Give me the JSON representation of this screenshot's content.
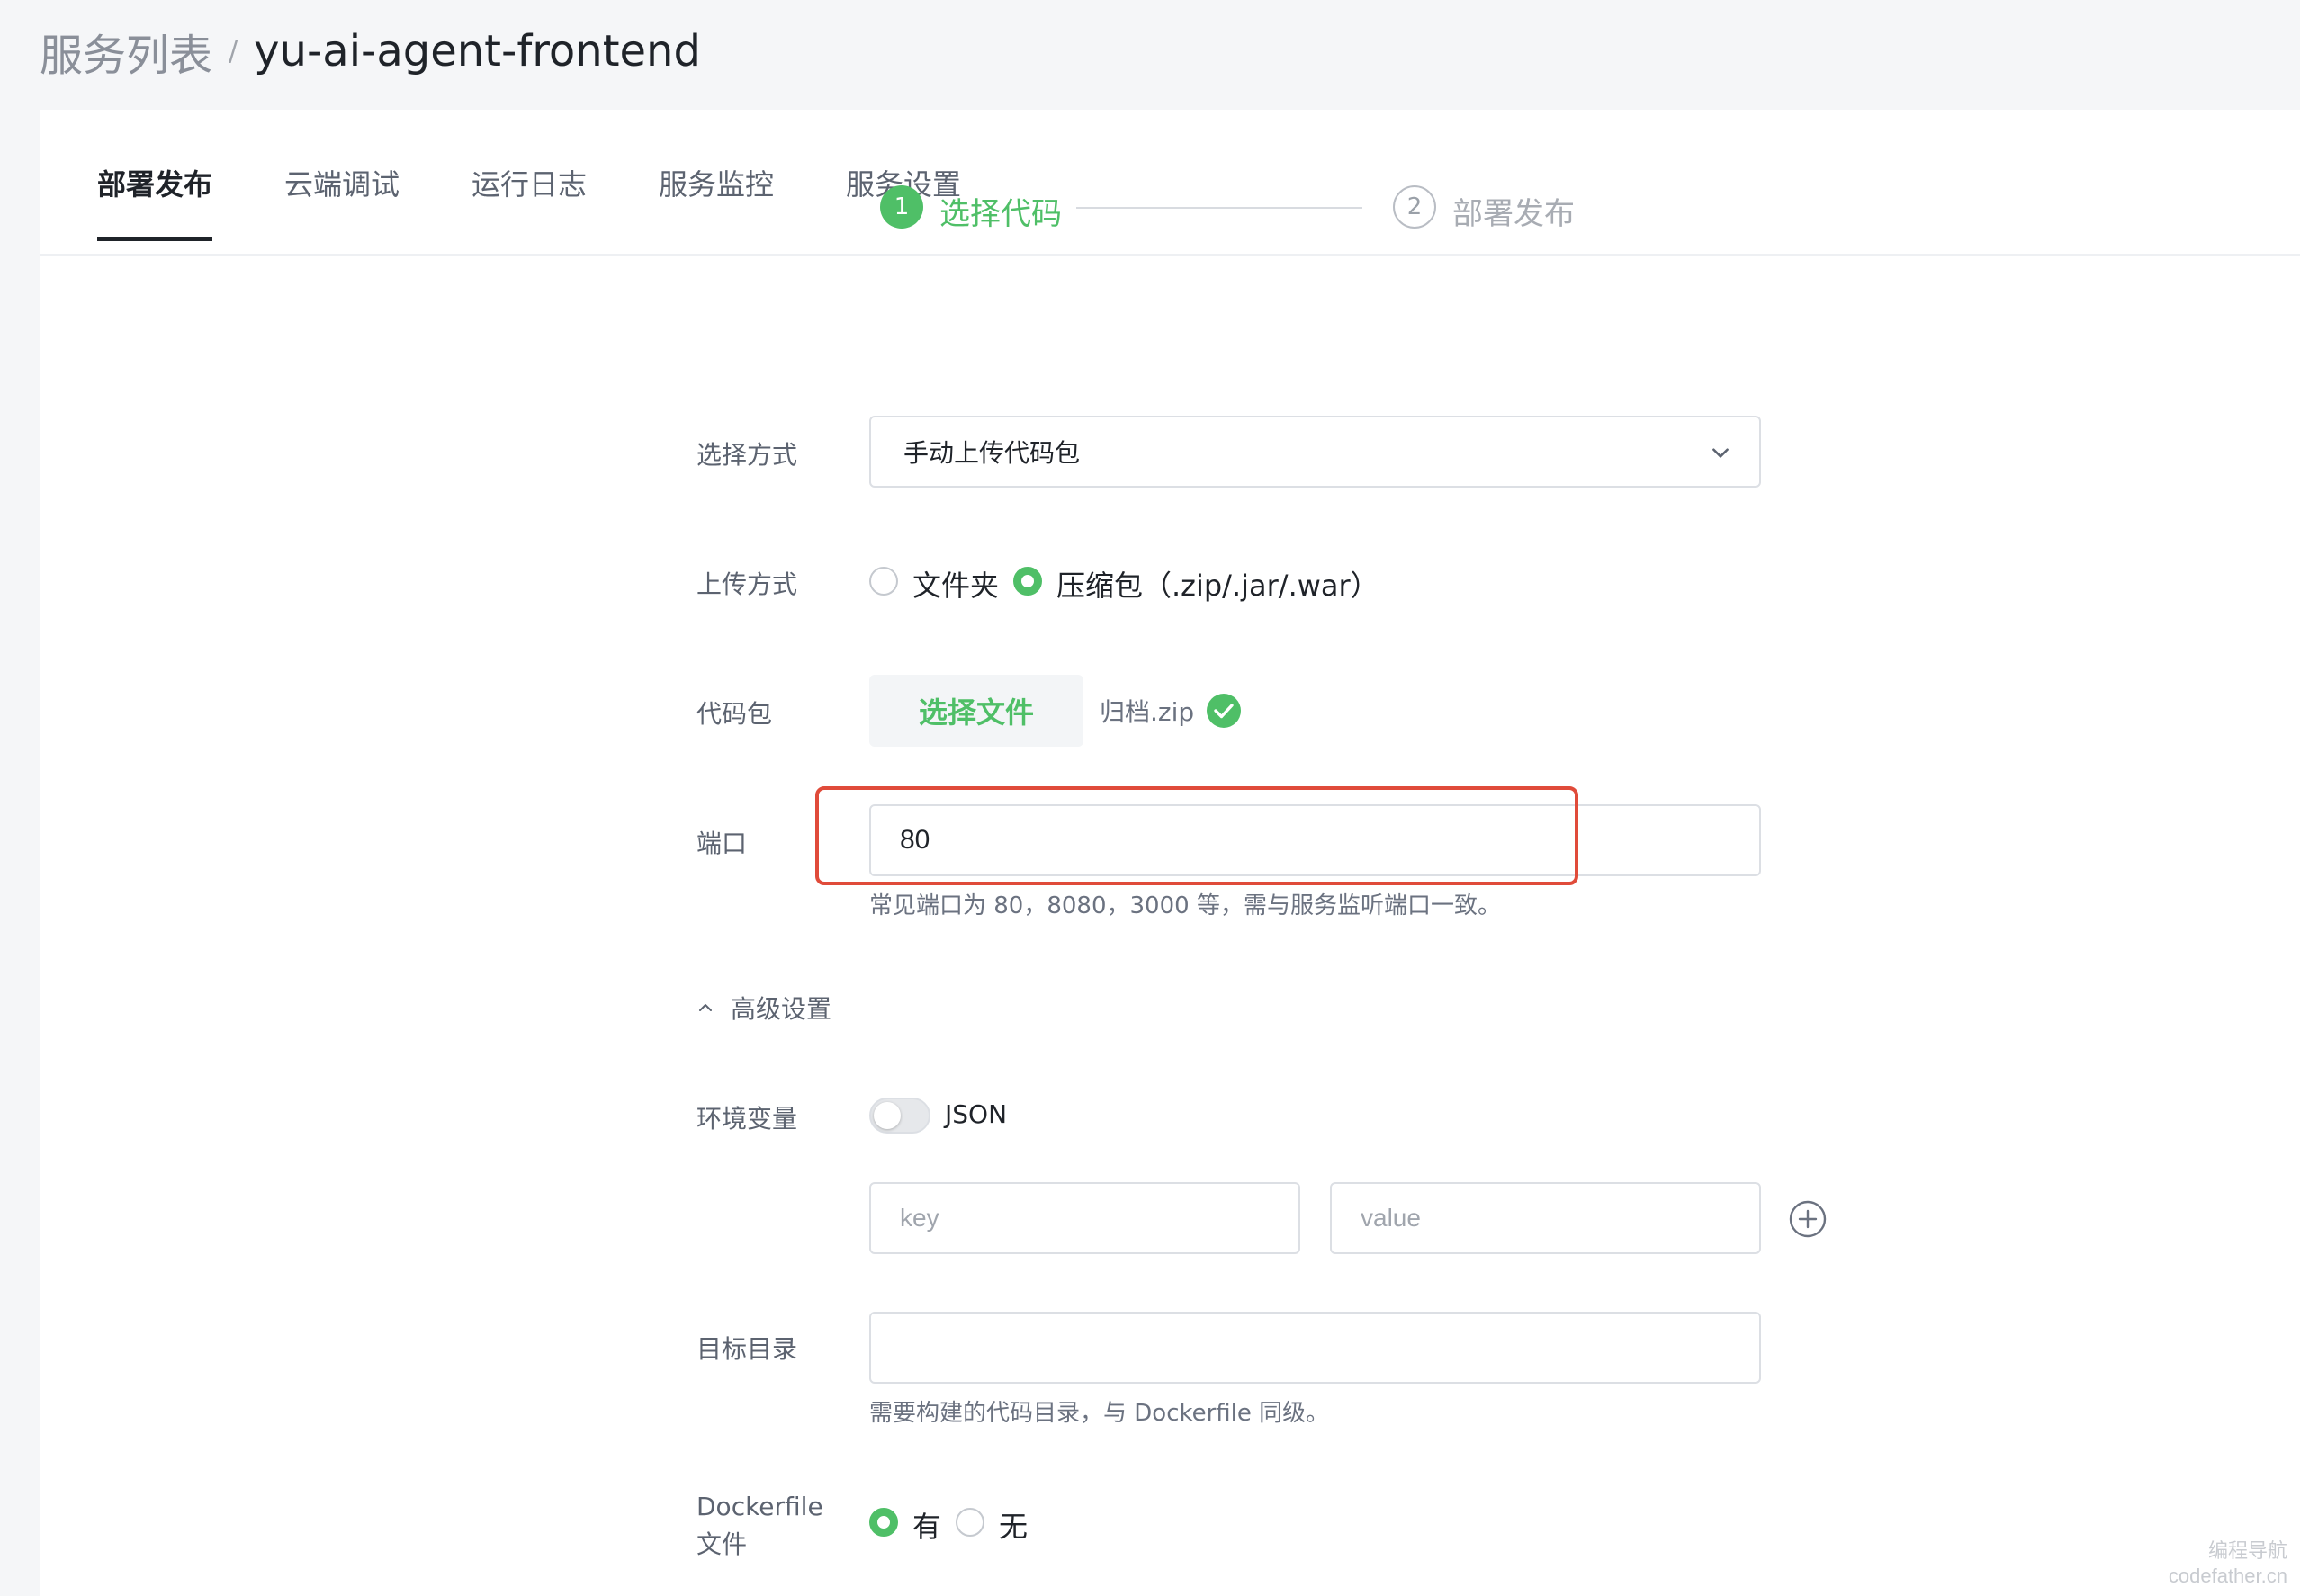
{
  "breadcrumb": {
    "parent": "服务列表",
    "separator": "/",
    "current": "yu-ai-agent-frontend"
  },
  "tabs": [
    {
      "label": "部署发布",
      "active": true
    },
    {
      "label": "云端调试",
      "active": false
    },
    {
      "label": "运行日志",
      "active": false
    },
    {
      "label": "服务监控",
      "active": false
    },
    {
      "label": "服务设置",
      "active": false
    }
  ],
  "steps": [
    {
      "number": "1",
      "label": "选择代码",
      "state": "active"
    },
    {
      "number": "2",
      "label": "部署发布",
      "state": "pending"
    }
  ],
  "form": {
    "method": {
      "label": "选择方式",
      "value": "手动上传代码包"
    },
    "upload": {
      "label": "上传方式",
      "options": [
        {
          "label": "文件夹",
          "selected": false
        },
        {
          "label": "压缩包（.zip/.jar/.war）",
          "selected": true
        }
      ]
    },
    "package": {
      "label": "代码包",
      "button": "选择文件",
      "file_name": "归档.zip"
    },
    "port": {
      "label": "端口",
      "value": "80",
      "hint": "常见端口为 80，8080，3000 等，需与服务监听端口一致。"
    },
    "advanced": {
      "label": "高级设置",
      "expanded": true
    },
    "env": {
      "label": "环境变量",
      "toggle_label": "JSON",
      "json_mode": false,
      "key_placeholder": "key",
      "value_placeholder": "value"
    },
    "target_dir": {
      "label": "目标目录",
      "value": "",
      "hint": "需要构建的代码目录，与 Dockerfile 同级。"
    },
    "dockerfile": {
      "label_line1": "Dockerfile",
      "label_line2": "文件",
      "options": [
        {
          "label": "有",
          "selected": true
        },
        {
          "label": "无",
          "selected": false
        }
      ]
    }
  },
  "watermark": {
    "line1": "编程导航",
    "line2": "codefather.cn"
  },
  "colors": {
    "accent": "#4fbf67",
    "highlight": "#e04b3a"
  }
}
